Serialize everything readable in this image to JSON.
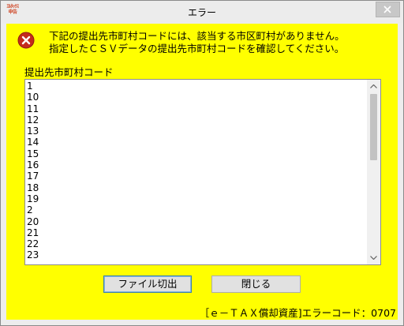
{
  "window": {
    "title": "エラー",
    "app_icon_text": "ｴﾙﾀｯｸｽ\n申告"
  },
  "message": {
    "line1": "下記の提出先市町村コードには、該当する市区町村がありません。",
    "line2": "指定したＣＳＶデータの提出先市町村コードを確認してください。"
  },
  "list": {
    "label": "提出先市町村コード",
    "items": [
      "1",
      "10",
      "11",
      "12",
      "13",
      "14",
      "15",
      "16",
      "17",
      "18",
      "19",
      "2",
      "20",
      "21",
      "22",
      "23"
    ]
  },
  "buttons": {
    "cut_file": "ファイル切出",
    "close": "閉じる"
  },
  "footer": {
    "error_code": "［ｅ－ＴＡＸ償却資産]エラーコード：0707"
  },
  "icons": {
    "error": "error-icon",
    "close": "close-icon",
    "scroll_up": "chevron-up-icon",
    "scroll_down": "chevron-down-icon"
  },
  "colors": {
    "background": "#ffff00",
    "error_icon": "#c42b1c"
  }
}
